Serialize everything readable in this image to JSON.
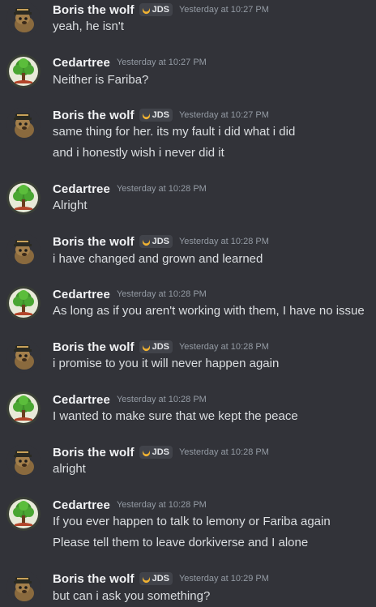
{
  "users": {
    "boris": {
      "name": "Boris the wolf",
      "tag": "JDS"
    },
    "cedar": {
      "name": "Cedartree"
    }
  },
  "messages": [
    {
      "timestamp": "Yesterday at 10:27 PM",
      "lines": [
        "yeah, he isn't"
      ]
    },
    {
      "timestamp": "Yesterday at 10:27 PM",
      "lines": [
        "Neither is Fariba?"
      ]
    },
    {
      "timestamp": "Yesterday at 10:27 PM",
      "lines": [
        "same thing for her. its my fault i did what i did",
        "and i honestly wish i never did it"
      ]
    },
    {
      "timestamp": "Yesterday at 10:28 PM",
      "lines": [
        "Alright"
      ]
    },
    {
      "timestamp": "Yesterday at 10:28 PM",
      "lines": [
        "i have changed and grown and learned"
      ]
    },
    {
      "timestamp": "Yesterday at 10:28 PM",
      "lines": [
        "As long as if you aren't working with them, I have no issue"
      ]
    },
    {
      "timestamp": "Yesterday at 10:28 PM",
      "lines": [
        "i promise to you it will never happen again"
      ]
    },
    {
      "timestamp": "Yesterday at 10:28 PM",
      "lines": [
        "I wanted to make sure that we kept the peace"
      ]
    },
    {
      "timestamp": "Yesterday at 10:28 PM",
      "lines": [
        "alright"
      ]
    },
    {
      "timestamp": "Yesterday at 10:28 PM",
      "lines": [
        "If you ever happen to talk to lemony or Fariba again",
        "Please tell them to leave dorkiverse and I alone"
      ]
    },
    {
      "timestamp": "Yesterday at 10:29 PM",
      "lines": [
        "but can i ask you something?"
      ]
    }
  ],
  "colors": {
    "background": "#323339",
    "username": "#f2f3f5",
    "text": "#dbdee1",
    "timestamp": "#949ba4",
    "tag_bg": "#41434a",
    "tag_icon": "#f0b232"
  },
  "icons": {
    "boris_avatar": "wolf-avatar-icon",
    "cedar_avatar": "tree-avatar-icon",
    "tag": "crescent-moon-icon"
  }
}
